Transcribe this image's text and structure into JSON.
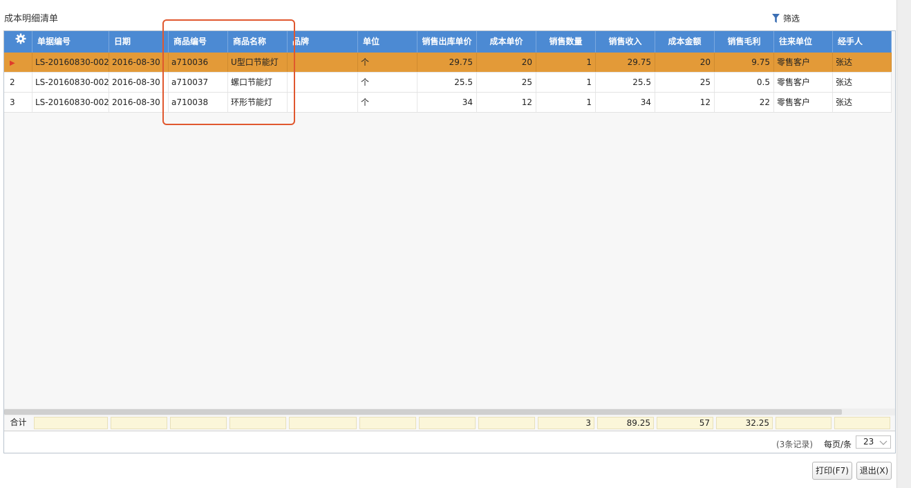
{
  "page": {
    "title": "成本明细清单",
    "filter_label": "筛选"
  },
  "table": {
    "columns": [
      "单据编号",
      "日期",
      "商品编号",
      "商品名称",
      "品牌",
      "单位",
      "销售出库单价",
      "成本单价",
      "销售数量",
      "销售收入",
      "成本金额",
      "销售毛利",
      "往来单位",
      "经手人"
    ],
    "rows": [
      {
        "row_header": "",
        "selected": true,
        "cells": [
          "LS-20160830-002",
          "2016-08-30",
          "a710036",
          "U型口节能灯",
          "",
          "个",
          "29.75",
          "20",
          "1",
          "29.75",
          "20",
          "9.75",
          "零售客户",
          "张达"
        ]
      },
      {
        "row_header": "2",
        "selected": false,
        "cells": [
          "LS-20160830-002",
          "2016-08-30",
          "a710037",
          "螺口节能灯",
          "",
          "个",
          "25.5",
          "25",
          "1",
          "25.5",
          "25",
          "0.5",
          "零售客户",
          "张达"
        ]
      },
      {
        "row_header": "3",
        "selected": false,
        "cells": [
          "LS-20160830-002",
          "2016-08-30",
          "a710038",
          "环形节能灯",
          "",
          "个",
          "34",
          "12",
          "1",
          "34",
          "12",
          "22",
          "零售客户",
          "张达"
        ]
      }
    ],
    "summary": {
      "label": "合计",
      "cells": [
        "",
        "",
        "",
        "",
        "",
        "",
        "",
        "",
        "3",
        "89.25",
        "57",
        "32.25",
        "",
        ""
      ]
    }
  },
  "footer": {
    "records": "(3条记录)",
    "per_page_label": "每页/条",
    "per_page_value": "23"
  },
  "buttons": {
    "print": "打印(F7)",
    "exit": "退出(X)"
  },
  "colors": {
    "header_bg": "#4c8ad3",
    "selected_row": "#e39a38",
    "summary_cell": "#fbf6d9",
    "annotation_box": "#e0572e",
    "row_arrow": "#e03b2a"
  },
  "icons": [
    "gear-icon",
    "filter-icon",
    "chevron-down-icon",
    "row-pointer-icon"
  ]
}
